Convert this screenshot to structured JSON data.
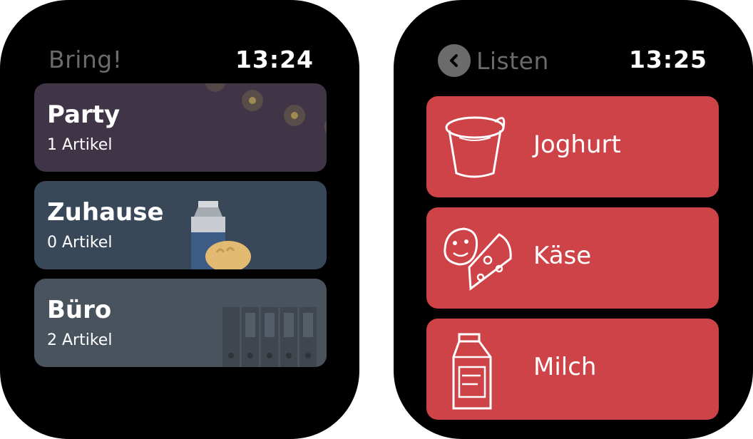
{
  "left_screen": {
    "app_title": "Bring!",
    "time": "13:24",
    "lists": [
      {
        "name": "Party",
        "count": "1 Artikel",
        "color": "#3f3547",
        "icon": "party-lights-icon"
      },
      {
        "name": "Zuhause",
        "count": "0 Artikel",
        "color": "#394859",
        "icon": "milk-bread-icon"
      },
      {
        "name": "Büro",
        "count": "2 Artikel",
        "color": "#49535d",
        "icon": "folders-icon"
      }
    ]
  },
  "right_screen": {
    "back_label": "Listen",
    "time": "13:25",
    "item_color": "#cd4348",
    "items": [
      {
        "name": "Joghurt",
        "icon": "yogurt-icon"
      },
      {
        "name": "Käse",
        "icon": "cheese-icon"
      },
      {
        "name": "Milch",
        "icon": "milk-carton-icon"
      }
    ]
  }
}
